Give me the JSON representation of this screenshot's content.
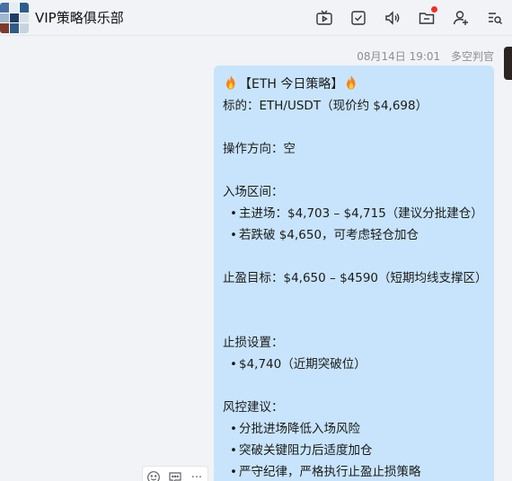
{
  "header": {
    "title": "VIP策略俱乐部",
    "avatar_colors": [
      "#4a6fa5",
      "#e6edf5",
      "#2f5d8a",
      "#9fb7cf",
      "#1f3f63",
      "#d9dfe6",
      "#7a3b2c",
      "#315b86",
      "#c9d3de"
    ],
    "icons": [
      "tv-icon",
      "checkbox-icon",
      "speaker-icon",
      "folder-icon",
      "add-user-icon",
      "search-list-icon"
    ]
  },
  "message": {
    "timestamp": "08月14日 19:01",
    "sender": "多空判官",
    "bubble_color": "#c8e4fc",
    "title": "【ETH 今日策略】",
    "target": "标的：ETH/USDT（现价约 $4,698）",
    "direction": "操作方向：空",
    "entry_heading": "入场区间：",
    "entry_items": [
      "主进场：$4,703 – $4,715（建议分批建仓）",
      "若跌破 $4,650，可考虑轻仓加仓"
    ],
    "tp": "止盈目标：$4,650 – $4590（短期均线支撑区）",
    "sl_heading": "止损设置：",
    "sl_items": [
      "$4,740（近期突破位）"
    ],
    "risk_heading": "风控建议：",
    "risk_items": [
      "分批进场降低入场风险",
      "突破关键阻力后适度加仓",
      "严守纪律，严格执行止盈止损策略"
    ],
    "bullet": "•"
  },
  "actions": {
    "emoji_icon": "emoji-icon",
    "reply_icon": "reply-icon",
    "more_label": "···"
  }
}
